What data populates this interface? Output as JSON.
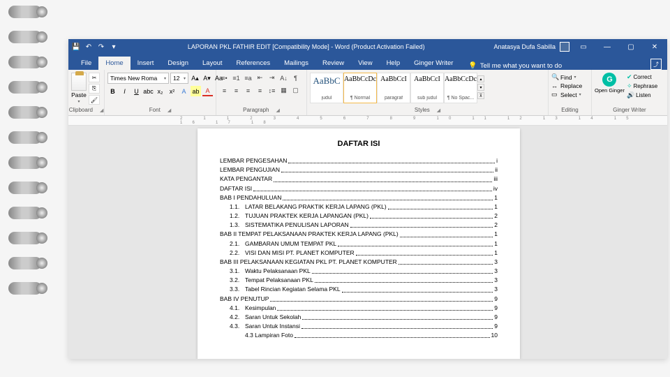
{
  "titlebar": {
    "title": "LAPORAN PKL FATHIR EDIT [Compatibility Mode] - Word (Product Activation Failed)",
    "user": "Anatasya Dufa Sabilla"
  },
  "tabs": {
    "file": "File",
    "home": "Home",
    "insert": "Insert",
    "design": "Design",
    "layout": "Layout",
    "references": "References",
    "mailings": "Mailings",
    "review": "Review",
    "view": "View",
    "help": "Help",
    "ginger": "Ginger Writer",
    "tellme": "Tell me what you want to do"
  },
  "ribbon": {
    "clipboard": {
      "label": "Clipboard",
      "paste": "Paste"
    },
    "font": {
      "label": "Font",
      "name": "Times New Roma",
      "size": "12"
    },
    "paragraph": {
      "label": "Paragraph"
    },
    "styles": {
      "label": "Styles",
      "items": [
        {
          "preview": "AaBbC",
          "name": "judul"
        },
        {
          "preview": "AaBbCcDc",
          "name": "¶ Normal"
        },
        {
          "preview": "AaBbCcI",
          "name": "paragraf"
        },
        {
          "preview": "AaBbCcI",
          "name": "sub judul"
        },
        {
          "preview": "AaBbCcDc",
          "name": "¶ No Spac..."
        }
      ]
    },
    "editing": {
      "label": "Editing",
      "find": "Find",
      "replace": "Replace",
      "select": "Select"
    },
    "ginger": {
      "label": "Ginger Writer",
      "open": "Open Ginger",
      "correct": "Correct",
      "rephrase": "Rephrase",
      "listen": "Listen"
    }
  },
  "ruler": "2 1 1 2 3 4 5 6 7 8 9 10 11 12 13 14 15 16 17 18",
  "doc": {
    "title": "DAFTAR ISI",
    "toc": [
      {
        "level": 0,
        "text": "LEMBAR PENGESAHAN",
        "page": "i"
      },
      {
        "level": 0,
        "text": "LEMBAR PENGUJIAN",
        "page": "ii"
      },
      {
        "level": 0,
        "text": "KATA PENGANTAR",
        "page": "iii"
      },
      {
        "level": 0,
        "text": "DAFTAR ISI",
        "page": "iv"
      },
      {
        "level": 0,
        "text": "BAB I PENDAHULUAN",
        "page": "1"
      },
      {
        "level": 1,
        "num": "1.1.",
        "text": "LATAR BELAKANG PRAKTIK KERJA LAPANG (PKL)",
        "page": "1"
      },
      {
        "level": 1,
        "num": "1.2.",
        "text": "TUJUAN PRAKTEK KERJA LAPANGAN (PKL)",
        "page": "2"
      },
      {
        "level": 1,
        "num": "1.3.",
        "text": "SISTEMATIKA PENULISAN LAPORAN",
        "page": "2"
      },
      {
        "level": 0,
        "text": "BAB II TEMPAT PELAKSANAAN PRAKTEK KERJA LAPANG (PKL)",
        "page": "1"
      },
      {
        "level": 1,
        "num": "2.1.",
        "text": "GAMBARAN UMUM TEMPAT PKL",
        "page": "1"
      },
      {
        "level": 1,
        "num": "2.2.",
        "text": "VISI DAN MISI PT. PLANET KOMPUTER",
        "page": "1"
      },
      {
        "level": 0,
        "text": "BAB III PELAKSANAAN KEGIATAN PKL  PT. PLANET KOMPUTER",
        "page": "3"
      },
      {
        "level": 1,
        "num": "3.1.",
        "text": "Waktu Pelaksanaan PKL",
        "page": "3"
      },
      {
        "level": 1,
        "num": "3.2.",
        "text": "Tempat Pelaksanaan PKL",
        "page": "3"
      },
      {
        "level": 1,
        "num": "3.3.",
        "text": "Tabel Rincian Kegiatan Selama PKL",
        "page": "3"
      },
      {
        "level": 0,
        "text": "BAB IV PENUTUP",
        "page": "9"
      },
      {
        "level": 1,
        "num": "4.1.",
        "text": "Kesimpulan",
        "page": "9"
      },
      {
        "level": 1,
        "num": "4.2.",
        "text": "Saran Untuk Sekolah",
        "page": "9"
      },
      {
        "level": 1,
        "num": "4.3.",
        "text": "Saran Untuk Instansi",
        "page": "9"
      },
      {
        "level": 1,
        "num": "",
        "text": "4.3 Lampiran Foto",
        "page": "10"
      }
    ]
  }
}
